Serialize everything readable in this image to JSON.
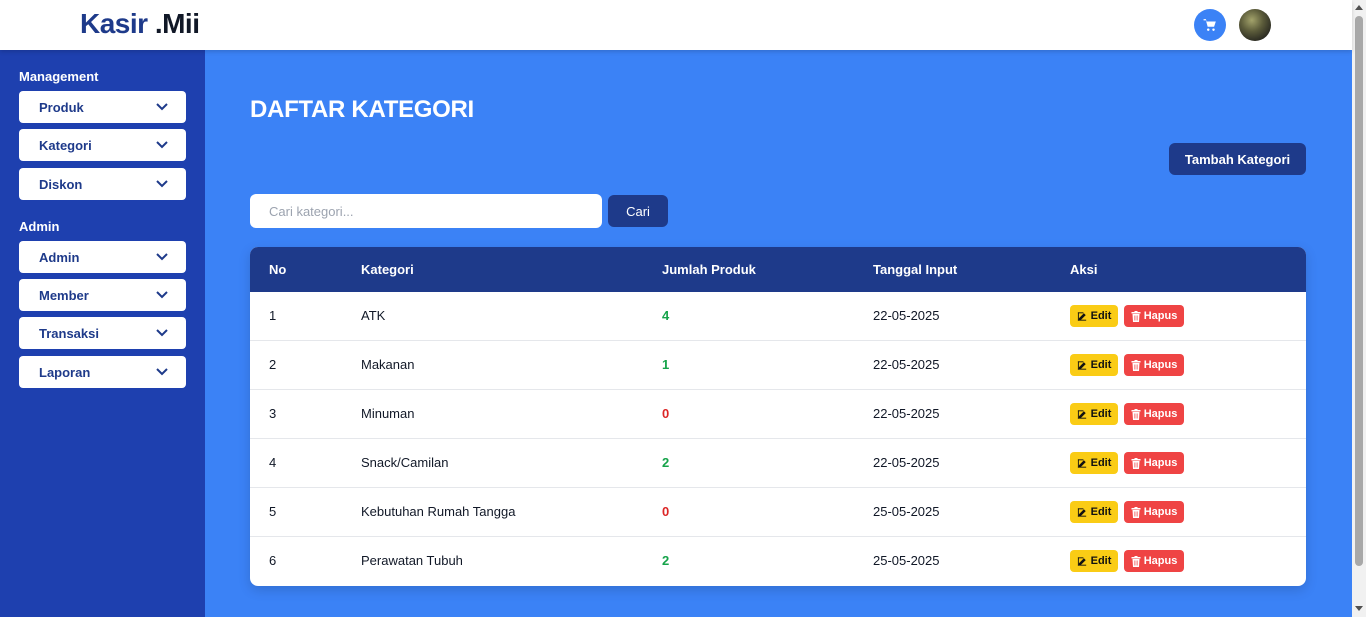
{
  "brand": {
    "name": "Kasir",
    "suffix": ".Mii"
  },
  "header": {
    "cart_icon": "cart-icon",
    "avatar": "user-avatar"
  },
  "sidebar": {
    "management_heading": "Management",
    "management_items": [
      {
        "label": "Produk"
      },
      {
        "label": "Kategori"
      },
      {
        "label": "Diskon"
      }
    ],
    "admin_heading": "Admin",
    "admin_items": [
      {
        "label": "Admin"
      },
      {
        "label": "Member"
      },
      {
        "label": "Transaksi"
      },
      {
        "label": "Laporan"
      }
    ]
  },
  "page": {
    "title": "DAFTAR KATEGORI",
    "add_button": "Tambah Kategori",
    "search_placeholder": "Cari kategori...",
    "search_button": "Cari"
  },
  "table": {
    "headers": [
      "No",
      "Kategori",
      "Jumlah Produk",
      "Tanggal Input",
      "Aksi"
    ],
    "rows": [
      {
        "no": "1",
        "kategori": "ATK",
        "jumlah": "4",
        "tanggal": "22-05-2025"
      },
      {
        "no": "2",
        "kategori": "Makanan",
        "jumlah": "1",
        "tanggal": "22-05-2025"
      },
      {
        "no": "3",
        "kategori": "Minuman",
        "jumlah": "0",
        "tanggal": "22-05-2025"
      },
      {
        "no": "4",
        "kategori": "Snack/Camilan",
        "jumlah": "2",
        "tanggal": "22-05-2025"
      },
      {
        "no": "5",
        "kategori": "Kebutuhan Rumah Tangga",
        "jumlah": "0",
        "tanggal": "25-05-2025"
      },
      {
        "no": "6",
        "kategori": "Perawatan Tubuh",
        "jumlah": "2",
        "tanggal": "25-05-2025"
      }
    ],
    "edit_label": "Edit",
    "delete_label": "Hapus"
  },
  "colors": {
    "brand_dark": "#1e3a8a",
    "sidebar_bg": "#1e40af",
    "main_bg": "#3b82f6",
    "positive": "#16a34a",
    "zero": "#dc2626",
    "edit": "#facc15",
    "delete": "#ef4444"
  }
}
